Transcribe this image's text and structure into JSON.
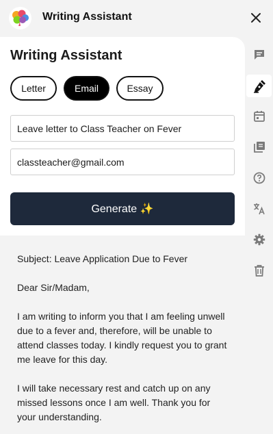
{
  "app": {
    "title": "Writing Assistant"
  },
  "panel": {
    "title": "Writing Assistant",
    "tabs": [
      {
        "label": "Letter",
        "active": false
      },
      {
        "label": "Email",
        "active": true
      },
      {
        "label": "Essay",
        "active": false
      }
    ],
    "topic_value": "Leave letter to Class Teacher on Fever",
    "recipient_value": "classteacher@gmail.com",
    "generate_label": "Generate ✨"
  },
  "output": {
    "subject": "Subject: Leave Application Due to Fever",
    "greeting": "Dear Sir/Madam,",
    "paragraph1": "I am writing to inform you that I am feeling unwell due to a fever and, therefore, will be unable to attend classes today. I kindly request you to grant me leave for this day.",
    "paragraph2": "I will take necessary rest and catch up on any missed lessons once I am well. Thank you for your understanding."
  },
  "sidebar": {
    "icons": [
      "chat-icon",
      "pen-icon",
      "calendar-icon",
      "library-icon",
      "help-icon",
      "translate-icon",
      "settings-icon",
      "trash-icon"
    ],
    "active": "pen-icon"
  },
  "colors": {
    "accent_dark": "#1e293b",
    "icon_gray": "#7a7a7a",
    "background": "#f3f3f3"
  }
}
